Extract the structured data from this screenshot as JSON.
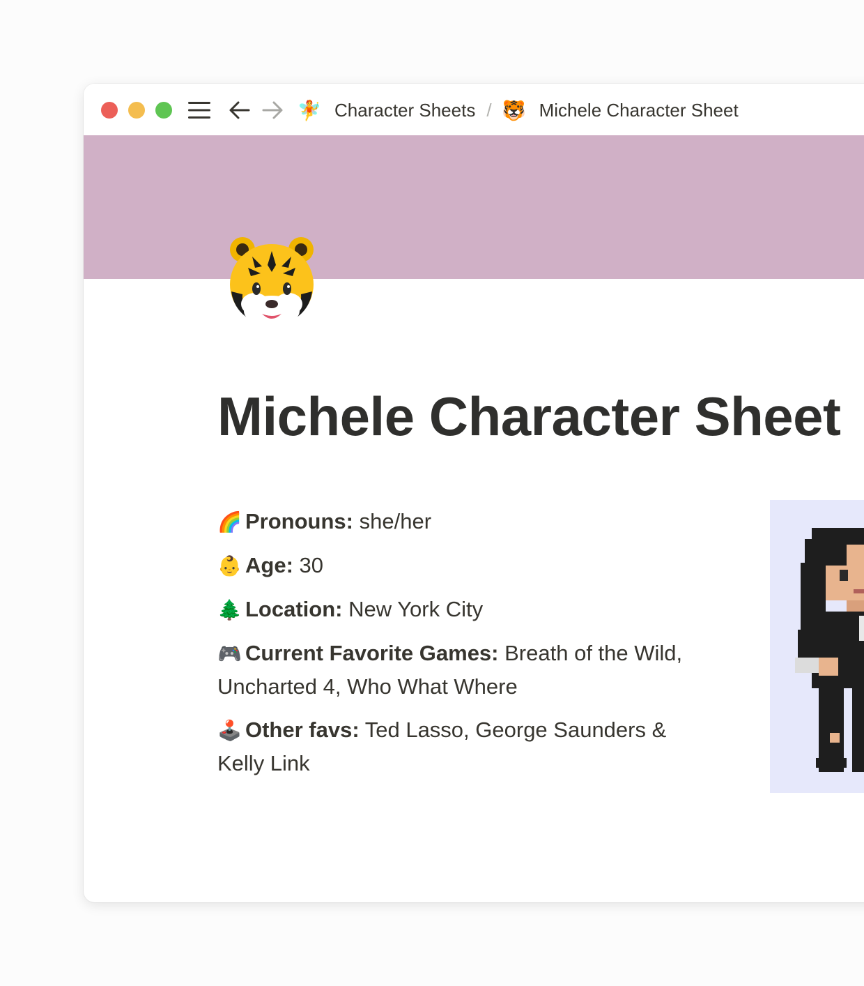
{
  "window": {
    "breadcrumb": [
      {
        "emoji": "🧚",
        "label": "Character Sheets"
      },
      {
        "emoji": "🐯",
        "label": "Michele Character Sheet"
      }
    ],
    "separator": "/"
  },
  "page": {
    "icon": "tiger-face-icon",
    "title": "Michele Character Sheet",
    "cover_color": "#d0b0c6"
  },
  "properties": [
    {
      "emoji": "🌈",
      "label": "Pronouns:",
      "value": "she/her"
    },
    {
      "emoji": "👶",
      "label": "Age:",
      "value": "30"
    },
    {
      "emoji": "🌲",
      "label": "Location:",
      "value": "New York City"
    },
    {
      "emoji": "🎮",
      "label": "Current Favorite Games:",
      "value": "Breath of the Wild, Uncharted 4, Who What Where"
    },
    {
      "emoji": "🕹️",
      "label": "Other favs:",
      "value": "Ted Lasso, George Saunders & Kelly Link"
    }
  ]
}
